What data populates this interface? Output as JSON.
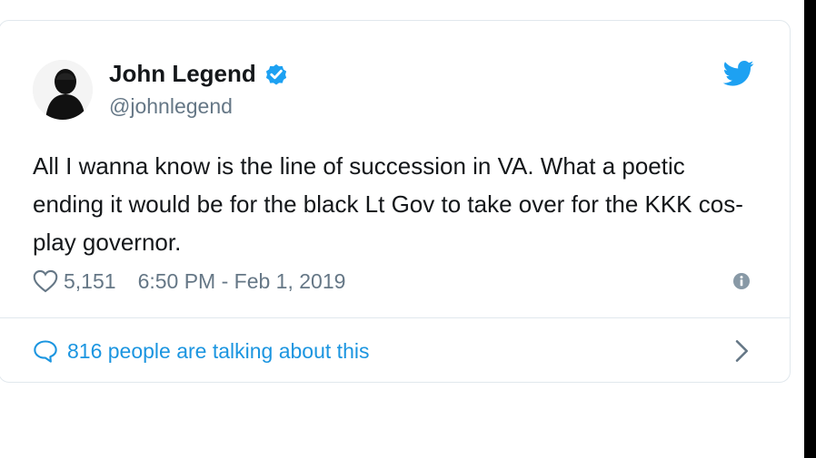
{
  "tweet": {
    "author_name": "John Legend",
    "author_handle": "@johnlegend",
    "text": "All I wanna know is the line of succession in VA. What a poetic ending it would be for the black Lt Gov to take over for the KKK cos-play governor.",
    "likes": "5,151",
    "timestamp": "6:50 PM - Feb 1, 2019",
    "talking_about": "816 people are talking about this"
  },
  "icons": {
    "verified": "verified-badge-icon",
    "brand": "twitter-bird-icon",
    "like": "heart-icon",
    "info": "info-icon",
    "reply": "speech-bubble-icon",
    "more": "chevron-right-icon"
  },
  "colors": {
    "twitter_blue": "#1da1f2",
    "link_blue": "#1b95e0",
    "text_primary": "#14171a",
    "text_secondary": "#657786",
    "border": "#e1e8ed"
  }
}
